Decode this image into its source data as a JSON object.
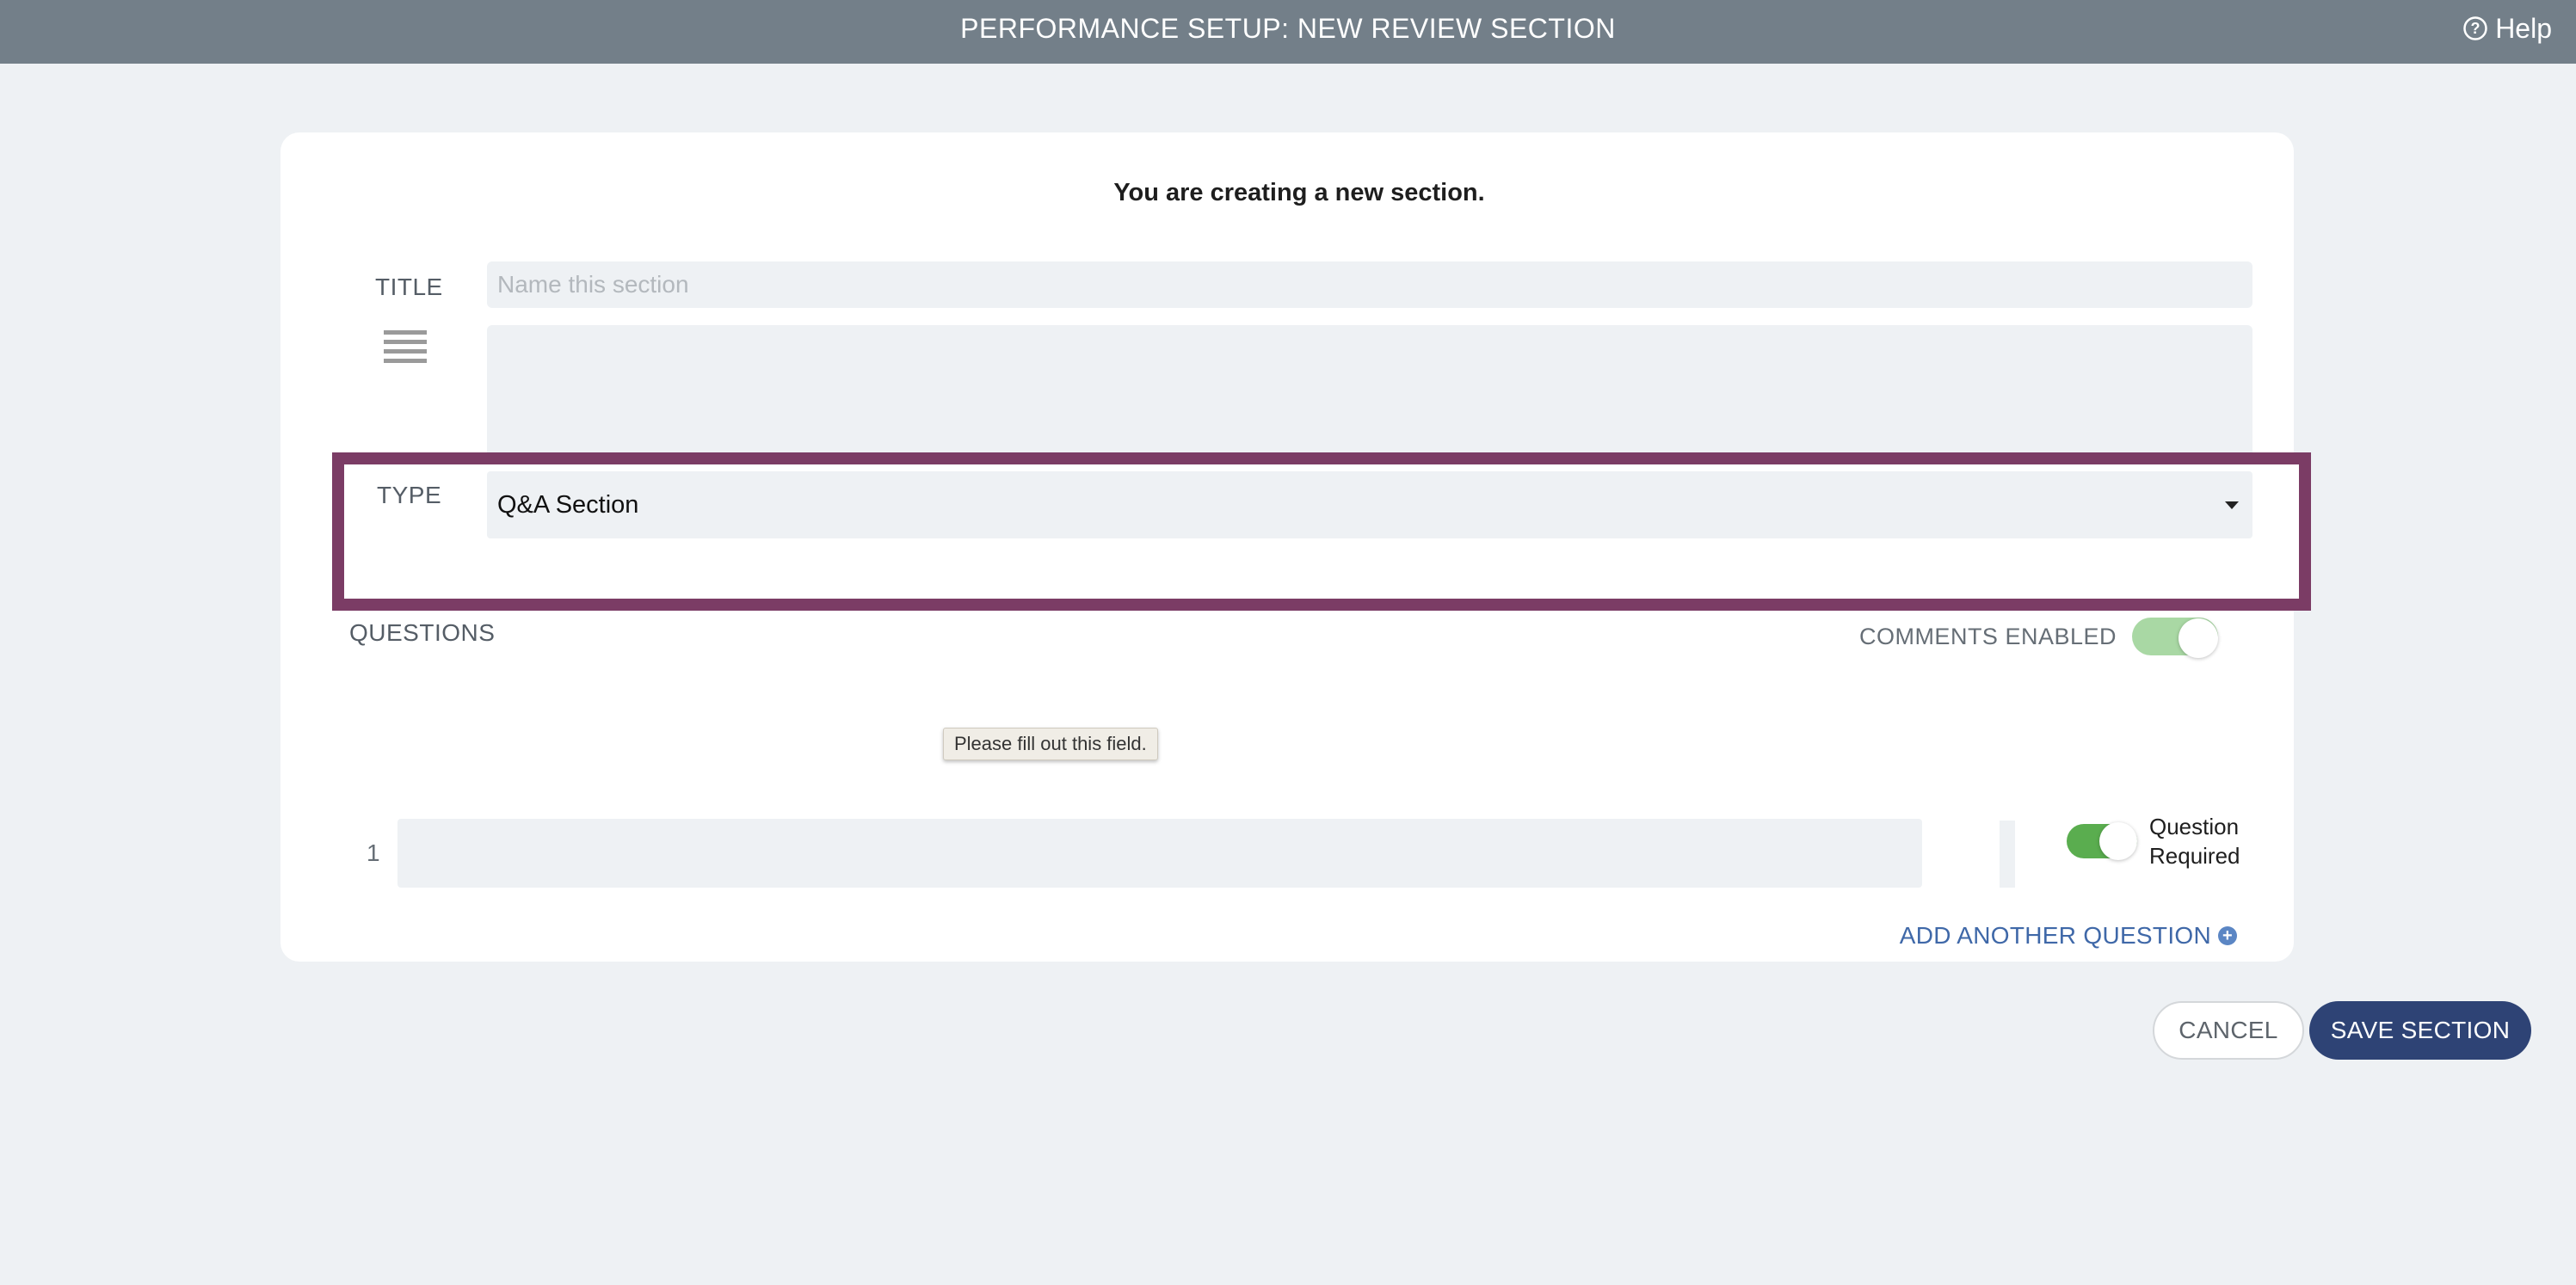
{
  "header": {
    "title": "PERFORMANCE SETUP: NEW REVIEW SECTION",
    "help_label": "Help",
    "help_icon": "question-circle-icon"
  },
  "form": {
    "heading": "You are creating a new section.",
    "title_label": "TITLE",
    "title_placeholder": "Name this section",
    "title_value": "",
    "description_icon": "text-align-icon",
    "description_value": "",
    "type_label": "TYPE",
    "type_selected": "Q&A Section",
    "highlight_color": "#7b3c65"
  },
  "questions": {
    "label": "QUESTIONS",
    "comments_label": "COMMENTS ENABLED",
    "comments_enabled": true,
    "items": [
      {
        "number": "1",
        "value": "",
        "required_label_line1": "Question",
        "required_label_line2": "Required",
        "required": true
      }
    ],
    "validation_tooltip": "Please fill out this field.",
    "add_label": "ADD ANOTHER QUESTION"
  },
  "actions": {
    "cancel_label": "CANCEL",
    "save_label": "SAVE SECTION",
    "save_color": "#2e4375"
  }
}
